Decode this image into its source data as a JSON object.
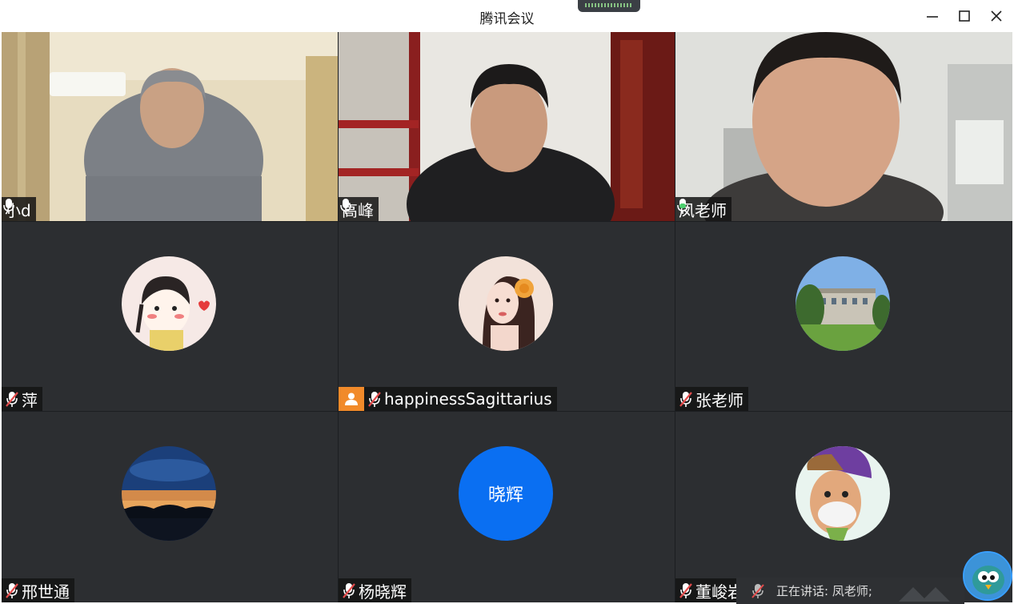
{
  "window": {
    "title": "腾讯会议"
  },
  "participants": [
    {
      "name": "小d"
    },
    {
      "name": "高峰"
    },
    {
      "name": "凤老师"
    },
    {
      "name": "萍"
    },
    {
      "name": "happinessSagittarius"
    },
    {
      "name": "张老师"
    },
    {
      "name": "邢世通"
    },
    {
      "name": "杨晓辉",
      "avatar_text": "晓辉"
    },
    {
      "name": "董峻岩"
    }
  ],
  "speaking": {
    "label": "正在讲话: 凤老师;"
  },
  "colors": {
    "tile_bg": "#2c2e31",
    "active_speaker_border": "#4ccf6e",
    "text_avatar_bg": "#0a6ff2",
    "person_badge": "#f18a2a",
    "muted_icon": "#e34b4b"
  }
}
